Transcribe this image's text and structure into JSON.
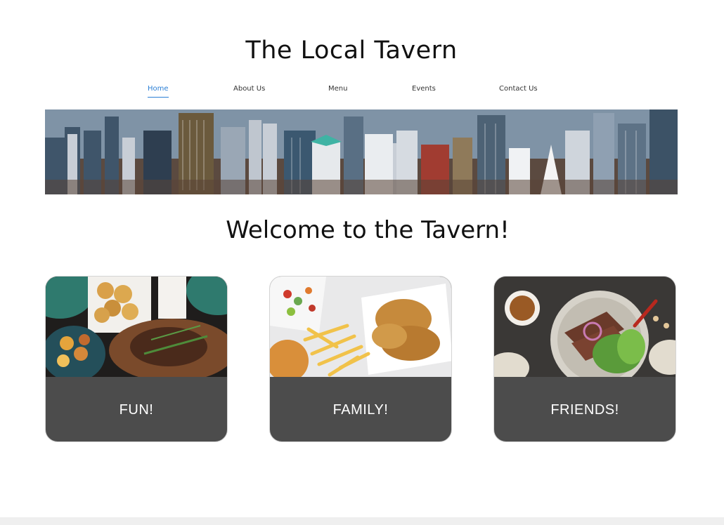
{
  "site": {
    "title": "The Local Tavern"
  },
  "nav": {
    "items": [
      {
        "label": "Home",
        "active": true
      },
      {
        "label": "About Us",
        "active": false
      },
      {
        "label": "Menu",
        "active": false
      },
      {
        "label": "Events",
        "active": false
      },
      {
        "label": "Contact Us",
        "active": false
      }
    ]
  },
  "hero": {
    "image": "city-skyline-aerial"
  },
  "main": {
    "heading": "Welcome to the Tavern!",
    "cards": [
      {
        "label": "FUN!",
        "image": "roast-meat-platter"
      },
      {
        "label": "FAMILY!",
        "image": "chicken-tenders-and-fries"
      },
      {
        "label": "FRIENDS!",
        "image": "sliced-steak-salad"
      }
    ]
  },
  "colors": {
    "accent": "#2b7fd6",
    "card_caption_bg": "#4c4c4c",
    "text": "#111111",
    "footer": "#efefef"
  }
}
